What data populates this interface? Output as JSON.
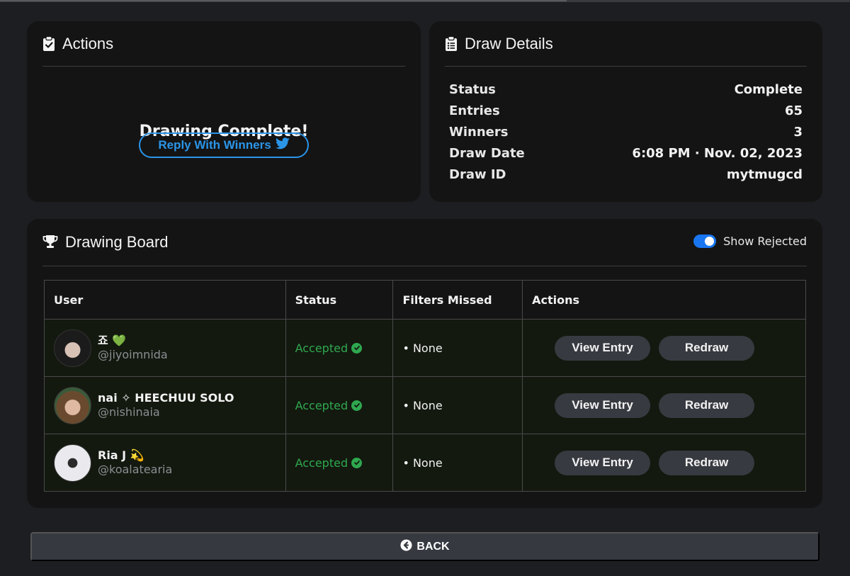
{
  "actions": {
    "title": "Actions",
    "message": "Drawing Complete!",
    "reply_button": "Reply With Winners"
  },
  "details": {
    "title": "Draw Details",
    "rows": [
      {
        "label": "Status",
        "value": "Complete"
      },
      {
        "label": "Entries",
        "value": "65"
      },
      {
        "label": "Winners",
        "value": "3"
      },
      {
        "label": "Draw Date",
        "value": "6:08 PM · Nov. 02, 2023"
      },
      {
        "label": "Draw ID",
        "value": "mytmugcd"
      }
    ]
  },
  "board": {
    "title": "Drawing Board",
    "toggle_label": "Show Rejected",
    "toggle_on": true,
    "columns": [
      "User",
      "Status",
      "Filters Missed",
      "Actions"
    ],
    "rows": [
      {
        "name": "죠 💚",
        "handle": "@jiyoimnida",
        "status": "Accepted",
        "filters": "• None",
        "view": "View Entry",
        "redraw": "Redraw"
      },
      {
        "name": "nai ✧ HEECHUU SOLO",
        "handle": "@nishinaia",
        "status": "Accepted",
        "filters": "• None",
        "view": "View Entry",
        "redraw": "Redraw"
      },
      {
        "name": "Ria J 💫",
        "handle": "@koalatearia",
        "status": "Accepted",
        "filters": "• None",
        "view": "View Entry",
        "redraw": "Redraw"
      }
    ]
  },
  "back_label": "BACK",
  "icons": {
    "actions": "clipboard-check-icon",
    "details": "clipboard-list-icon",
    "board": "trophy-icon",
    "reply": "twitter-bird-icon",
    "accepted": "check-circle-icon",
    "back": "arrow-circle-left-icon"
  },
  "colors": {
    "accent_blue": "#2b95e8",
    "toggle_blue": "#1976f0",
    "accepted_green": "#2fa84f",
    "card_bg": "#141414",
    "page_bg": "#1d1e21"
  }
}
